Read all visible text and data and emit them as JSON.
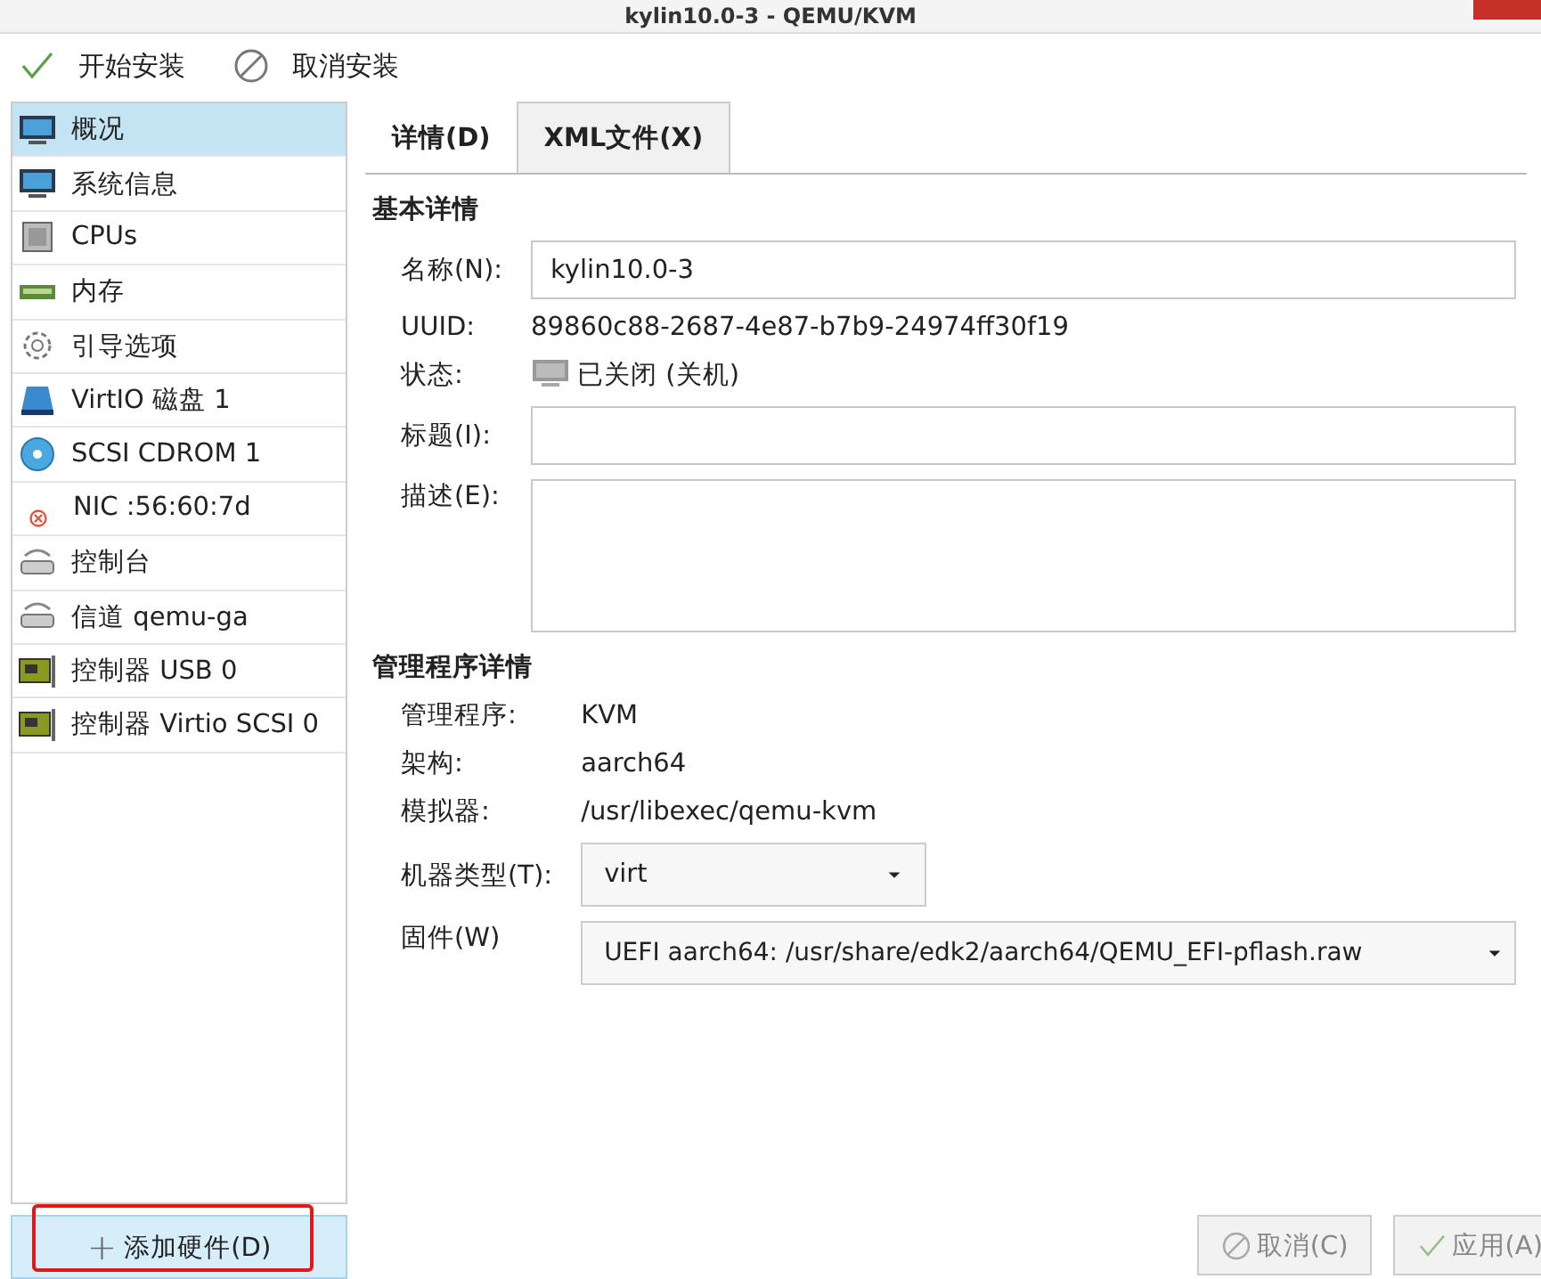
{
  "window": {
    "title": "kylin10.0-3 - QEMU/KVM"
  },
  "toolbar": [
    {
      "label": "开始安装",
      "kind": "check"
    },
    {
      "label": "取消安装",
      "kind": "cancel"
    }
  ],
  "sidebar": {
    "items": [
      {
        "label": "概况",
        "kind": "monitor",
        "selected": true
      },
      {
        "label": "系统信息",
        "kind": "monitor",
        "selected": false
      },
      {
        "label": "CPUs",
        "kind": "chip",
        "selected": false
      },
      {
        "label": "内存",
        "kind": "ram",
        "selected": false
      },
      {
        "label": "引导选项",
        "kind": "gear",
        "selected": false
      },
      {
        "label": "VirtIO 磁盘 1",
        "kind": "disk",
        "selected": false
      },
      {
        "label": "SCSI CDROM 1",
        "kind": "cd",
        "selected": false
      },
      {
        "label": "NIC :56:60:7d",
        "kind": "error",
        "selected": false
      },
      {
        "label": "控制台",
        "kind": "serial",
        "selected": false
      },
      {
        "label": "信道 qemu-ga",
        "kind": "serial",
        "selected": false
      },
      {
        "label": "控制器 USB 0",
        "kind": "card",
        "selected": false
      },
      {
        "label": "控制器 Virtio SCSI 0",
        "kind": "card",
        "selected": false
      }
    ],
    "add_button": {
      "symbol": "+",
      "label": "添加硬件(D)",
      "highlighted": true
    }
  },
  "tabs": [
    {
      "label": "详情(D)",
      "selected": true
    },
    {
      "label": "XML文件(X)",
      "selected": false
    }
  ],
  "basic": {
    "heading": "基本详情",
    "rows": [
      {
        "kind": "input",
        "label": "名称(N):",
        "value": "kylin10.0-3"
      },
      {
        "kind": "text",
        "label": "UUID:",
        "value": "89860c88-2687-4e87-b7b9-24974ff30f19"
      },
      {
        "kind": "status",
        "label": "状态:",
        "value": "已关闭 (关机)"
      },
      {
        "kind": "input",
        "label": "标题(I):"
      },
      {
        "kind": "textarea",
        "label": "描述(E):"
      }
    ]
  },
  "hypervisor": {
    "heading": "管理程序详情",
    "rows": [
      {
        "kind": "text",
        "label": "管理程序:",
        "value": "KVM"
      },
      {
        "kind": "text",
        "label": "架构:",
        "value": "aarch64"
      },
      {
        "kind": "text",
        "label": "模拟器:",
        "value": "/usr/libexec/qemu-kvm"
      },
      {
        "kind": "select",
        "label": "机器类型(T):",
        "value": "virt"
      },
      {
        "kind": "select_wide",
        "label": "固件(W)",
        "value": "UEFI aarch64: /usr/share/edk2/aarch64/QEMU_EFI-pflash.raw"
      }
    ]
  },
  "buttons": [
    {
      "label": "取消(C)",
      "kind": "cancel",
      "disabled": true
    },
    {
      "label": "应用(A)",
      "kind": "check",
      "disabled": true
    }
  ]
}
